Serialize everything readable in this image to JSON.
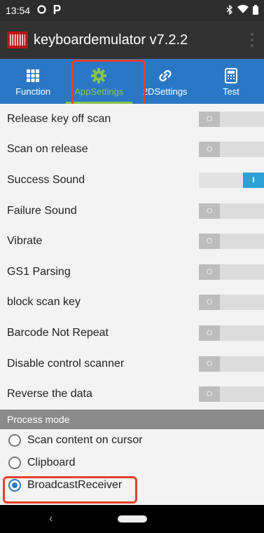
{
  "status_bar": {
    "time": "13:54",
    "left_icons": [
      "notification-icon",
      "p-notification-icon"
    ],
    "right_icons": [
      "bluetooth-icon",
      "wifi-icon",
      "battery-icon"
    ]
  },
  "app_bar": {
    "title": "keyboardemulator v7.2.2",
    "logo_icon": "barcode-logo-icon"
  },
  "tabs": [
    {
      "label": "Function",
      "icon": "grid-icon",
      "active": false
    },
    {
      "label": "AppSettings",
      "icon": "gear-icon",
      "active": true
    },
    {
      "label": "2DSettings",
      "icon": "link-icon",
      "active": false
    },
    {
      "label": "Test",
      "icon": "calculator-icon",
      "active": false
    }
  ],
  "settings": [
    {
      "label": "Release key off scan",
      "state": "off",
      "knob": "O"
    },
    {
      "label": "Scan on release",
      "state": "off",
      "knob": "O"
    },
    {
      "label": "Success Sound",
      "state": "on",
      "knob": "I"
    },
    {
      "label": "Failure Sound",
      "state": "off",
      "knob": "O"
    },
    {
      "label": "Vibrate",
      "state": "off",
      "knob": "O"
    },
    {
      "label": "GS1 Parsing",
      "state": "off",
      "knob": "O"
    },
    {
      "label": "block scan key",
      "state": "off",
      "knob": "O"
    },
    {
      "label": "Barcode Not Repeat",
      "state": "off",
      "knob": "O"
    },
    {
      "label": "Disable control scanner",
      "state": "off",
      "knob": "O"
    },
    {
      "label": "Reverse the data",
      "state": "off",
      "knob": "O"
    }
  ],
  "process_mode": {
    "header": "Process mode",
    "options": [
      {
        "label": "Scan content on cursor",
        "checked": false
      },
      {
        "label": "Clipboard",
        "checked": false
      },
      {
        "label": "BroadcastReceiver",
        "checked": true
      }
    ]
  },
  "nav_bar": {
    "back_glyph": "‹"
  },
  "colors": {
    "tab_bar": "#2a78c5",
    "active_tab": "#8bc34a",
    "toggle_on": "#2ba1d8",
    "highlight": "#e4412b"
  }
}
